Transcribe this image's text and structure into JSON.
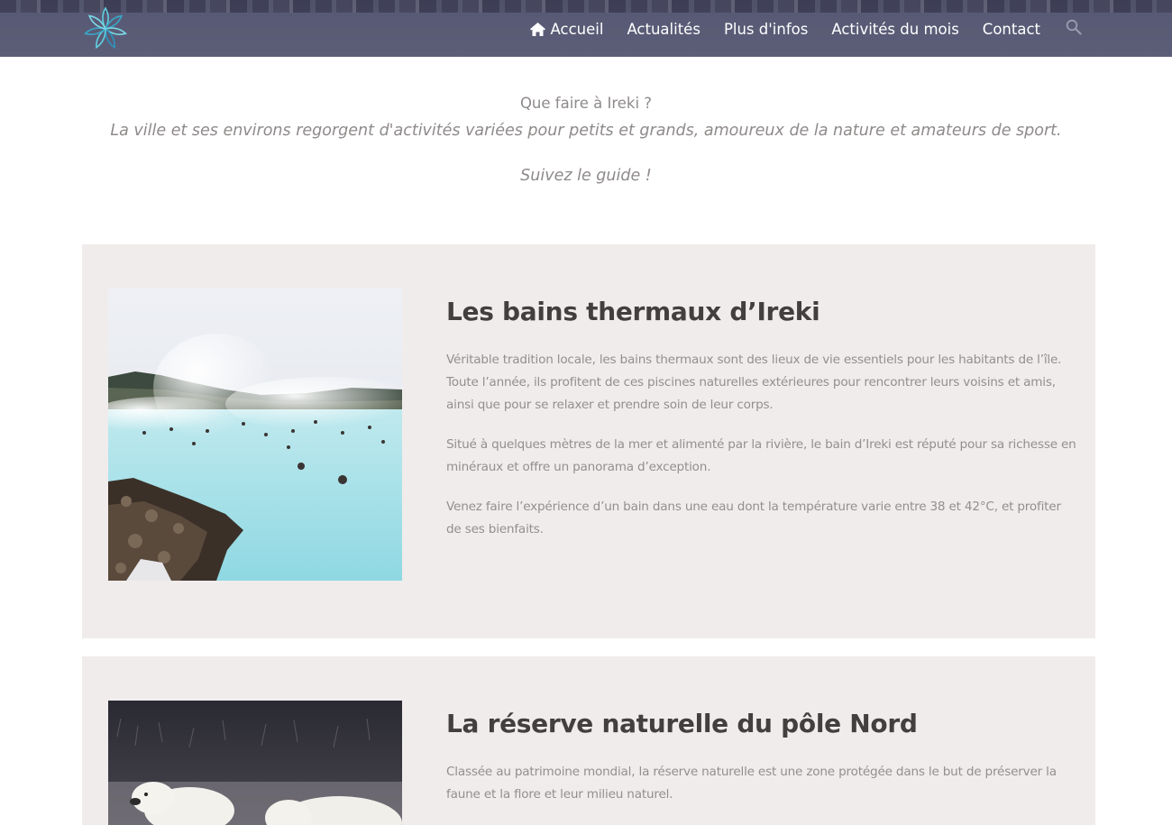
{
  "nav": {
    "items": [
      {
        "label": "Accueil",
        "icon": "home-icon"
      },
      {
        "label": "Actualités"
      },
      {
        "label": "Plus d'infos"
      },
      {
        "label": "Activités du mois"
      },
      {
        "label": "Contact"
      }
    ],
    "search_icon": "search-icon",
    "logo_icon": "flower-logo-icon"
  },
  "intro": {
    "title": "Que faire à Ireki ?",
    "text": "La ville et ses environs regorgent d'activités variées pour petits et grands, amoureux de la nature et amateurs de sport.",
    "guide": "Suivez le guide !"
  },
  "sections": [
    {
      "title": "Les bains thermaux d’Ireki",
      "image": "thermal-baths-photo",
      "paragraphs": [
        "Véritable tradition locale, les bains thermaux sont des lieux de vie essentiels pour les habitants de l’île. Toute l’année, ils profitent de ces piscines naturelles extérieures pour rencontrer leurs voisins et amis, ainsi que pour se relaxer et prendre soin de leur corps.",
        "Situé à quelques mètres de la mer et alimenté par la rivière, le bain d’Ireki est réputé pour sa richesse en minéraux et offre un panorama d’exception.",
        "Venez faire l’expérience d’un bain dans une eau dont la température varie entre 38 et 42°C, et profiter de ses bienfaits."
      ]
    },
    {
      "title": "La réserve naturelle du pôle Nord",
      "image": "polar-bear-photo",
      "paragraphs": [
        "Classée au patrimoine mondial, la réserve naturelle est une zone protégée dans le but de préserver la faune et la flore et leur milieu naturel."
      ]
    }
  ],
  "colors": {
    "header_bg": "#5c5e78",
    "section_bg": "#f0ecec",
    "heading": "#433f3f",
    "text": "#948f8f"
  }
}
